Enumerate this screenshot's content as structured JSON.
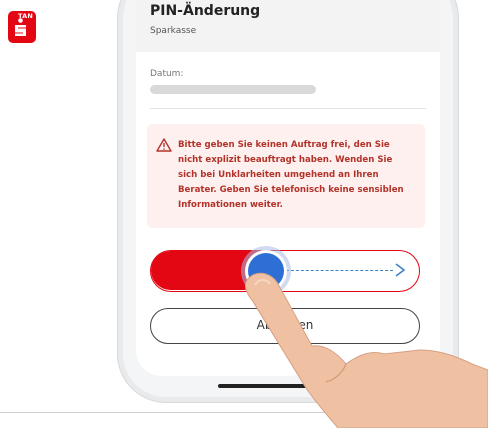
{
  "app_logo": {
    "badge": "TAN",
    "icon": "sparkasse-s-icon",
    "brand_color": "#e30613"
  },
  "header": {
    "title": "PIN-Änderung",
    "subtitle": "Sparkasse"
  },
  "details": {
    "date_label": "Datum:"
  },
  "warning": {
    "icon": "warning-triangle-icon",
    "text": "Bitte geben Sie keinen Auftrag frei, den Sie nicht explizit beauftragt haben. Wenden Sie sich bei Unklarheiten umgehend an Ihren Berater. Geben Sie telefonisch keine sensiblen Informationen weiter.",
    "color": "#b3332a",
    "background": "#fdf0ee"
  },
  "slider": {
    "icon": "arrow-right-icon",
    "knob_color": "#2e6fd6",
    "accent": "#e30613"
  },
  "cancel": {
    "label": "Ablehnen"
  }
}
